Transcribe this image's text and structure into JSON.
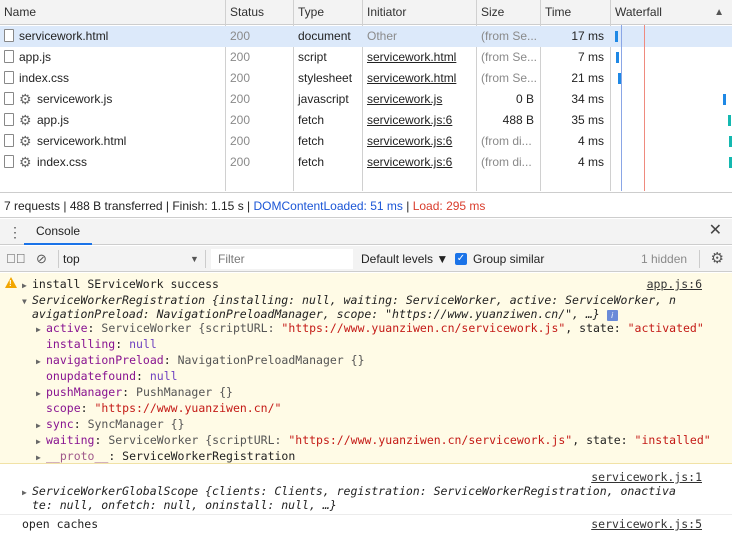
{
  "network": {
    "columns": [
      "Name",
      "Status",
      "Type",
      "Initiator",
      "Size",
      "Time",
      "Waterfall"
    ],
    "rows": [
      {
        "name": "servicework.html",
        "status": "200",
        "type": "document",
        "initiator": "Other",
        "size": "(from Se...",
        "time": "17 ms",
        "icon": "file-icon",
        "selected": true
      },
      {
        "name": "app.js",
        "status": "200",
        "type": "script",
        "initiator": "servicework.html",
        "size": "(from Se...",
        "time": "7 ms",
        "icon": "file-icon"
      },
      {
        "name": "index.css",
        "status": "200",
        "type": "stylesheet",
        "initiator": "servicework.html",
        "size": "(from Se...",
        "time": "21 ms",
        "icon": "file-icon"
      },
      {
        "name": "servicework.js",
        "status": "200",
        "type": "javascript",
        "initiator": "servicework.js",
        "size": "0 B",
        "time": "34 ms",
        "icon": "gear-icon"
      },
      {
        "name": "app.js",
        "status": "200",
        "type": "fetch",
        "initiator": "servicework.js:6",
        "size": "488 B",
        "time": "35 ms",
        "icon": "gear-icon"
      },
      {
        "name": "servicework.html",
        "status": "200",
        "type": "fetch",
        "initiator": "servicework.js:6",
        "size": "(from di...",
        "time": "4 ms",
        "icon": "gear-icon"
      },
      {
        "name": "index.css",
        "status": "200",
        "type": "fetch",
        "initiator": "servicework.js:6",
        "size": "(from di...",
        "time": "4 ms",
        "icon": "gear-icon"
      }
    ]
  },
  "status_bar": {
    "summary": "7 requests | 488 B transferred | Finish: 1.15 s | ",
    "dom_content_loaded": "DOMContentLoaded: 51 ms",
    "divider": " | ",
    "load": "Load: 295 ms"
  },
  "drawer": {
    "tab": "Console"
  },
  "toolbar": {
    "context": "top",
    "filter_placeholder": "Filter",
    "levels": "Default levels ▼",
    "group_similar": "Group similar",
    "hidden": "1 hidden"
  },
  "console": {
    "msg1_text": "install SErviceWork success",
    "msg1_src": "app.js:6",
    "obj_summary_1": "ServiceWorkerRegistration {installing: null, waiting: ServiceWorker, active: ServiceWorker, n",
    "obj_summary_2": "avigationPreload: NavigationPreloadManager, scope: \"https://www.yuanziwen.cn/\", …}",
    "props": [
      {
        "key": "active",
        "sep": ": ",
        "value": "ServiceWorker {scriptURL: ",
        "str": "\"https://www.yuanziwen.cn/servicework.js\"",
        "tail": ", state: ",
        "tail_str": "\"activated\"",
        "expandable": true
      },
      {
        "key": "installing",
        "sep": ": ",
        "value": "null",
        "expandable": false
      },
      {
        "key": "navigationPreload",
        "sep": ": ",
        "value": "NavigationPreloadManager {}",
        "expandable": true
      },
      {
        "key": "onupdatefound",
        "sep": ": ",
        "value": "null",
        "expandable": false
      },
      {
        "key": "pushManager",
        "sep": ": ",
        "value": "PushManager {}",
        "expandable": true
      },
      {
        "key": "scope",
        "sep": ": ",
        "value": "",
        "str": "\"https://www.yuanziwen.cn/\"",
        "expandable": false
      },
      {
        "key": "sync",
        "sep": ": ",
        "value": "SyncManager {}",
        "expandable": true
      },
      {
        "key": "waiting",
        "sep": ": ",
        "value": "ServiceWorker {scriptURL: ",
        "str": "\"https://www.yuanziwen.cn/servicework.js\"",
        "tail": ", state: ",
        "tail_str": "\"installed\"",
        "expandable": true
      },
      {
        "key": "__proto__",
        "sep": ": ",
        "value": "ServiceWorkerRegistration",
        "expandable": true
      }
    ],
    "msg2_src": "servicework.js:1",
    "msg2_line1": "ServiceWorkerGlobalScope {clients: Clients, registration: ServiceWorkerRegistration, onactiva",
    "msg2_line2": "te: null, onfetch: null, oninstall: null, …}",
    "msg3_text": "open caches",
    "msg3_src": "servicework.js:5"
  },
  "colors": {
    "selected_row": "#dce9fa",
    "dom_content_loaded": "#1a55d6",
    "load": "#d93c2c",
    "warning_bg": "#fffbe6",
    "waterfall_bar": "#1e88e5",
    "waterfall_bar_alt": "#14b8b0"
  }
}
